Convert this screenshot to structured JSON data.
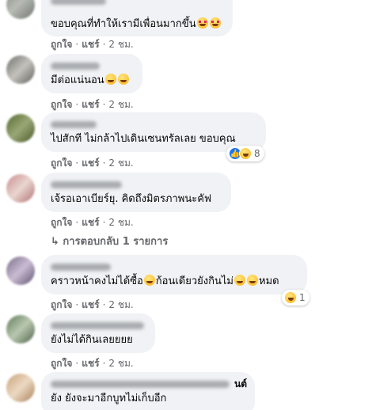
{
  "action_labels": {
    "like": "ถูกใจ",
    "reply": "แชร์",
    "separator": "·"
  },
  "comments": [
    {
      "text": "ขอบคุณที่ทำให้เรามีเพื่อนมากขึ้น",
      "time": "2 ชม.",
      "emojis": [
        "smiling-face-with-hearts",
        "heart-eyes-face"
      ]
    },
    {
      "text": "มีต่อแน่นอน",
      "time": "2 ชม.",
      "emojis": [
        "grinning-face",
        "grinning-face"
      ]
    },
    {
      "author_visible": "",
      "text": "ไปสักที ไม่กล้าไปเดินเซนทรัลเลย ขอบคุณ",
      "time": "2 ชม.",
      "reactions": {
        "icons": [
          "like",
          "haha"
        ],
        "count": "8"
      }
    },
    {
      "text": "เจ้รอเอาเบียร์ยุ. คิดถึงมิตรภาพนะคัฟ",
      "time": "2 ชม.",
      "replies_link": "↳ การตอบกลับ 1 รายการ"
    },
    {
      "text_parts": [
        "คราวหน้าคงไม่ได้ซื้อ",
        "ก้อนเดียวยังกินไม่",
        "หมด"
      ],
      "time": "2 ชม.",
      "emojis": [
        "grinning-face",
        "rolling-laughing-face",
        "rolling-laughing-face"
      ],
      "reactions": {
        "icons": [
          "haha"
        ],
        "count": "1"
      }
    },
    {
      "text": "ยังไม่ได้กินเลยยยย",
      "time": "2 ชม."
    },
    {
      "author_tail": "นต์",
      "text": "ยัง ยังจะมาอีกบูทไม่เก็บอีก"
    }
  ]
}
